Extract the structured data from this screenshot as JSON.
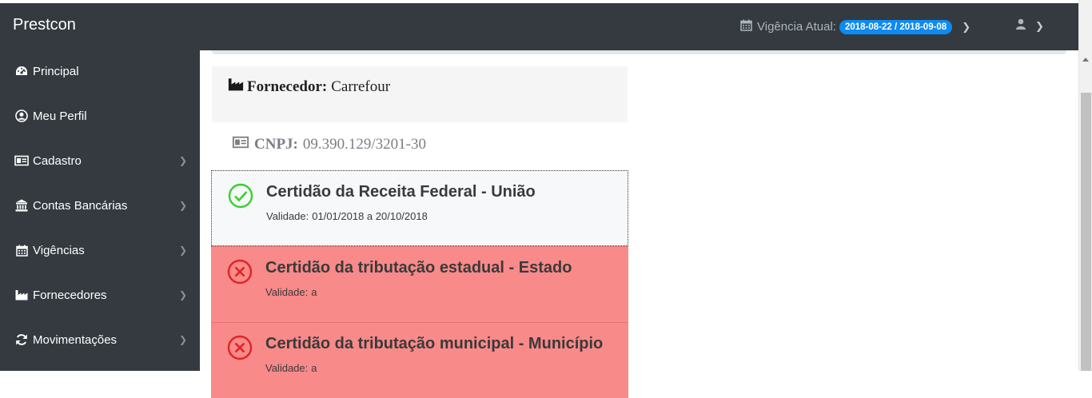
{
  "app": {
    "brand": "Prestcon"
  },
  "header": {
    "vigencia_label": "Vigência Atual:",
    "vigencia_badge": "2018-08-22 / 2018-09-08"
  },
  "sidebar": {
    "items": [
      {
        "label": "Principal",
        "icon": "dashboard-icon",
        "has_arrow": false
      },
      {
        "label": "Meu Perfil",
        "icon": "user-circle-icon",
        "has_arrow": false
      },
      {
        "label": "Cadastro",
        "icon": "id-card-icon",
        "has_arrow": true
      },
      {
        "label": "Contas Bancárias",
        "icon": "bank-icon",
        "has_arrow": true
      },
      {
        "label": "Vigências",
        "icon": "calendar-icon",
        "has_arrow": true
      },
      {
        "label": "Fornecedores",
        "icon": "industry-icon",
        "has_arrow": true
      },
      {
        "label": "Movimentações",
        "icon": "sync-icon",
        "has_arrow": true
      }
    ]
  },
  "main": {
    "fornecedor_label": "Fornecedor:",
    "fornecedor_value": "Carrefour",
    "cnpj_label": "CNPJ:",
    "cnpj_value": "09.390.129/3201-30",
    "validade_label": "Validade:",
    "certidoes": [
      {
        "title": "Certidão da Receita Federal - União",
        "validade": "01/01/2018 a 20/10/2018",
        "status": "valid"
      },
      {
        "title": "Certidão da tributação estadual - Estado",
        "validade": "a",
        "status": "invalid"
      },
      {
        "title": "Certidão da tributação municipal - Município",
        "validade": "a",
        "status": "invalid"
      }
    ]
  },
  "colors": {
    "topbar": "#343a40",
    "badge": "#0d8bf2",
    "valid": "#37d12f",
    "invalid": "#e02424",
    "invalid_bg": "#f88a89"
  }
}
